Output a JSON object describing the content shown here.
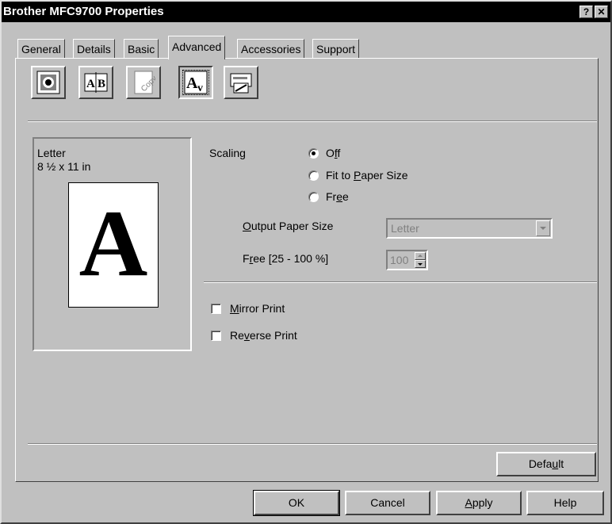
{
  "window": {
    "title": "Brother MFC9700 Properties",
    "help_glyph": "?",
    "close_glyph": "✕"
  },
  "tabs": [
    {
      "label": "General"
    },
    {
      "label": "Details"
    },
    {
      "label": "Basic"
    },
    {
      "label": "Advanced",
      "active": true
    },
    {
      "label": "Accessories"
    },
    {
      "label": "Support"
    }
  ],
  "toolbar_icons": [
    "quality-icon",
    "duplex-icon",
    "watermark-icon",
    "device-options-icon",
    "printer-settings-icon"
  ],
  "preview": {
    "paper_name": "Letter",
    "paper_dims": "8 ½ x 11 in",
    "sample_letter": "A"
  },
  "scaling": {
    "label": "Scaling",
    "options": [
      {
        "pre": "O",
        "u": "f",
        "post": "f",
        "checked": true
      },
      {
        "pre": "Fit to ",
        "u": "P",
        "post": "aper Size",
        "checked": false
      },
      {
        "pre": "Fr",
        "u": "e",
        "post": "e",
        "checked": false
      }
    ]
  },
  "output_paper": {
    "label_u": "O",
    "label_rest": "utput Paper Size",
    "value": "Letter"
  },
  "free_range": {
    "label_pre": "F",
    "label_u": "r",
    "label_post": "ee [25 - 100 %]",
    "value": "100"
  },
  "mirror": {
    "u": "M",
    "rest": "irror Print",
    "checked": false
  },
  "reverse": {
    "pre": "Re",
    "u": "v",
    "post": "erse Print",
    "checked": false
  },
  "default_btn": {
    "pre": "Defa",
    "u": "u",
    "post": "lt"
  },
  "footer": {
    "ok": "OK",
    "cancel": "Cancel",
    "apply_u": "A",
    "apply_rest": "pply",
    "help": "Help"
  }
}
